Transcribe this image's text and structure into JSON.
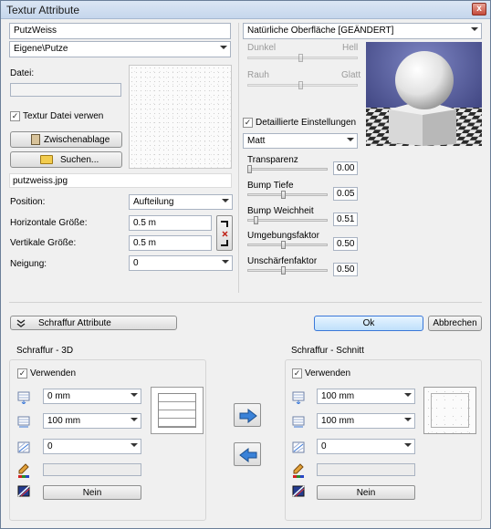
{
  "window": {
    "title": "Textur Attribute",
    "close": "x"
  },
  "left": {
    "name_value": "PutzWeiss",
    "category_value": "Eigene\\Putze",
    "file_label": "Datei:",
    "file_value": "",
    "use_file_label": "Textur Datei verwen",
    "use_file_checked": true,
    "clipboard_label": "Zwischenablage",
    "search_label": "Suchen...",
    "filename": "putzweiss.jpg",
    "position_label": "Position:",
    "position_value": "Aufteilung",
    "hsize_label": "Horizontale Größe:",
    "hsize_value": "0.5 m",
    "vsize_label": "Vertikale Größe:",
    "vsize_value": "0.5 m",
    "tilt_label": "Neigung:",
    "tilt_value": "0"
  },
  "right": {
    "surface_value": "Natürliche Oberfläche [GEÄNDERT]",
    "dark_label": "Dunkel",
    "bright_label": "Hell",
    "rough_label": "Rauh",
    "smooth_label": "Glatt",
    "detailed_label": "Detaillierte Einstellungen",
    "detailed_checked": true,
    "finish_value": "Matt",
    "params": [
      {
        "label": "Transparenz",
        "value": "0.00",
        "level": 0.0
      },
      {
        "label": "Bump Tiefe",
        "value": "0.05",
        "level": 0.45
      },
      {
        "label": "Bump Weichheit",
        "value": "0.51",
        "level": 0.08
      },
      {
        "label": "Umgebungsfaktor",
        "value": "0.50",
        "level": 0.45
      },
      {
        "label": "Unschärfenfaktor",
        "value": "0.50",
        "level": 0.45
      }
    ]
  },
  "actions": {
    "hatch_attr_label": "Schraffur Attribute",
    "ok_label": "Ok",
    "cancel_label": "Abbrechen"
  },
  "hatch3d": {
    "title": "Schraffur - 3D",
    "use_label": "Verwenden",
    "use_checked": true,
    "spacing_value": "0 mm",
    "width_value": "100 mm",
    "angle_value": "0",
    "color_value": "",
    "fill_label": "Nein"
  },
  "hatchcut": {
    "title": "Schraffur - Schnitt",
    "use_label": "Verwenden",
    "use_checked": true,
    "spacing_value": "100 mm",
    "width_value": "100 mm",
    "angle_value": "0",
    "color_value": "",
    "fill_label": "Nein"
  },
  "colors": {
    "accent": "#3a78d8",
    "ok_bg": "#dbeeff"
  },
  "icons": {
    "close": "close-icon",
    "clipboard": "clipboard-icon",
    "folder": "folder-icon",
    "chain": "chain-link-icon",
    "double_chevron": "double-chevron-down-icon",
    "arrow_right": "arrow-right-icon",
    "arrow_left": "arrow-left-icon",
    "spacing": "hatch-spacing-icon",
    "width": "hatch-width-icon",
    "angle": "hatch-angle-icon",
    "pen": "pen-color-icon",
    "fill": "fill-pattern-icon"
  }
}
